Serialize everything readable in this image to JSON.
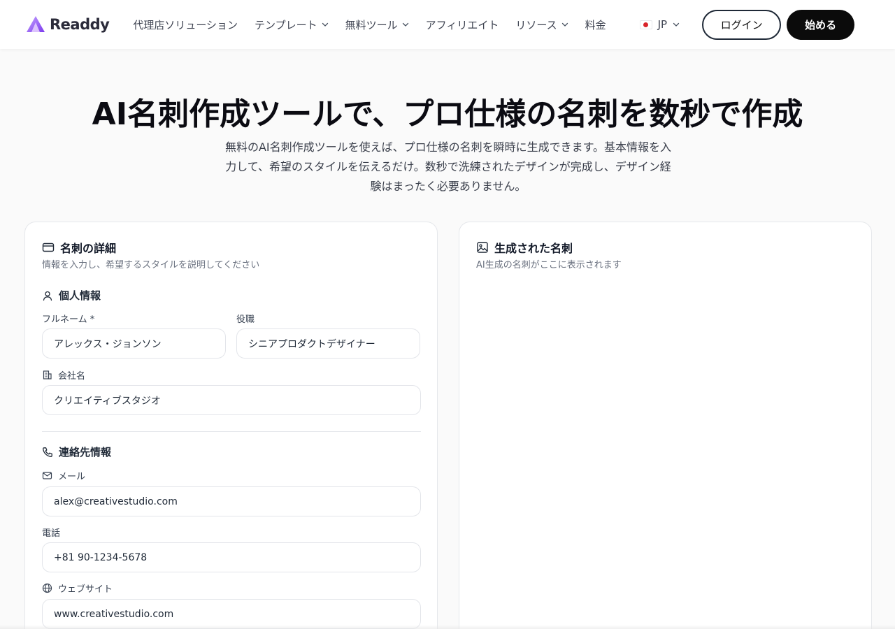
{
  "brand": {
    "name": "Readdy",
    "accent": "#8b5cf6"
  },
  "nav": {
    "items": [
      {
        "label": "代理店ソリューション",
        "has_dropdown": false
      },
      {
        "label": "テンプレート",
        "has_dropdown": true
      },
      {
        "label": "無料ツール",
        "has_dropdown": true
      },
      {
        "label": "アフィリエイト",
        "has_dropdown": false
      },
      {
        "label": "リソース",
        "has_dropdown": true
      },
      {
        "label": "料金",
        "has_dropdown": false
      }
    ],
    "language": "JP",
    "login_label": "ログイン",
    "start_label": "始める"
  },
  "hero": {
    "title": "AI名刺作成ツールで、プロ仕様の名刺を数秒で作成",
    "subtitle": "無料のAI名刺作成ツールを使えば、プロ仕様の名刺を瞬時に生成できます。基本情報を入力して、希望のスタイルを伝えるだけ。数秒で洗練されたデザインが完成し、デザイン経験はまったく必要ありません。"
  },
  "form": {
    "title": "名刺の詳細",
    "description": "情報を入力し、希望するスタイルを説明してください",
    "personal": {
      "title": "個人情報",
      "full_name_label": "フルネーム *",
      "full_name_value": "アレックス・ジョンソン",
      "job_title_label": "役職",
      "job_title_value": "シニアプロダクトデザイナー",
      "company_label": "会社名",
      "company_value": "クリエイティブスタジオ"
    },
    "contact": {
      "title": "連絡先情報",
      "email_label": "メール",
      "email_value": "alex@creativestudio.com",
      "phone_label": "電話",
      "phone_value": "+81 90-1234-5678",
      "website_label": "ウェブサイト",
      "website_value": "www.creativestudio.com"
    }
  },
  "preview": {
    "title": "生成された名刺",
    "description": "AI生成の名刺がここに表示されます"
  }
}
